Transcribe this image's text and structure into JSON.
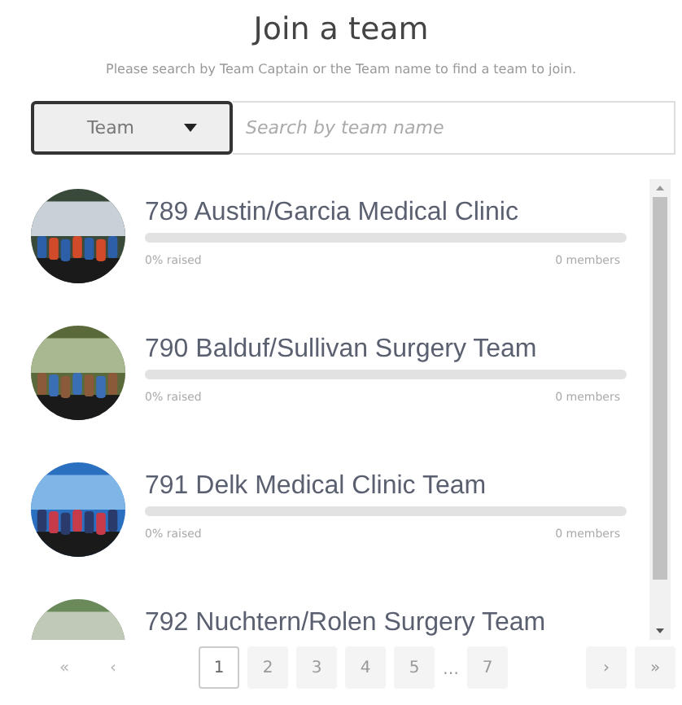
{
  "title": "Join a team",
  "subtitle": "Please search by Team Captain or the Team name to find a team to join.",
  "search": {
    "filter": "Team",
    "placeholder": "Search by team name"
  },
  "teams": [
    {
      "name": "789 Austin/Garcia Medical Clinic",
      "level": 0,
      "raised": "0% raised",
      "members": "0 members"
    },
    {
      "name": "790 Balduf/Sullivan Surgery Team",
      "level": 0,
      "raised": "0% raised",
      "members": "0 members"
    },
    {
      "name": "791 Delk Medical Clinic Team",
      "level": 0,
      "raised": "0% raised",
      "members": "0 members"
    },
    {
      "name": "792 Nuchtern/Rolen Surgery Team"
    }
  ],
  "pagination": {
    "prev": [
      {
        "label": "«",
        "disabled": true
      },
      {
        "label": "‹",
        "disabled": true
      }
    ],
    "pages": [
      {
        "kind": "page",
        "label": "1",
        "selected": true
      },
      {
        "kind": "page",
        "label": "2",
        "selected": false
      },
      {
        "kind": "page",
        "label": "3",
        "selected": false
      },
      {
        "kind": "page",
        "label": "4",
        "selected": false
      },
      {
        "kind": "page",
        "label": "5",
        "selected": false
      },
      {
        "kind": "ellipsis",
        "label": "…"
      },
      {
        "kind": "page",
        "label": "7",
        "selected": false
      }
    ],
    "next": [
      {
        "label": "›",
        "disabled": false
      },
      {
        "label": "»",
        "disabled": false
      }
    ]
  }
}
